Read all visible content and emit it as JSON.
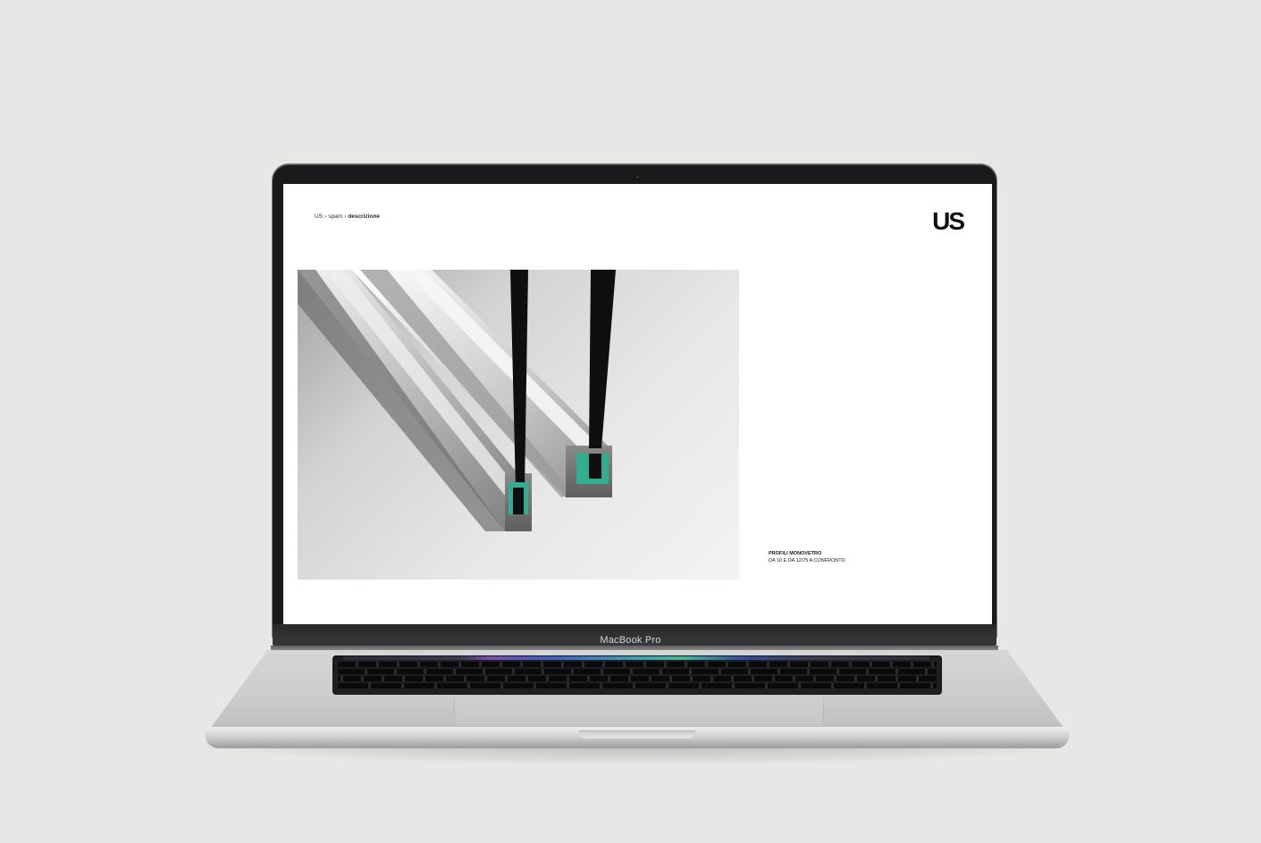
{
  "device": {
    "brand_label": "MacBook Pro"
  },
  "webpage": {
    "breadcrumb": {
      "root": "US",
      "separator": "›",
      "middle": "spam",
      "current": "descrizione"
    },
    "logo_text": "US",
    "hero": {
      "alt": "aluminium glass profiles render",
      "accent_color": "#2fae91"
    },
    "caption": {
      "title": "PROFILI MONOVETRO",
      "subtitle": "DA 10 E DA 12/75 A CONFRONTO"
    }
  },
  "colors": {
    "background": "#e7e7e6",
    "screen": "#ffffff",
    "bezel": "#1a1a1c"
  }
}
